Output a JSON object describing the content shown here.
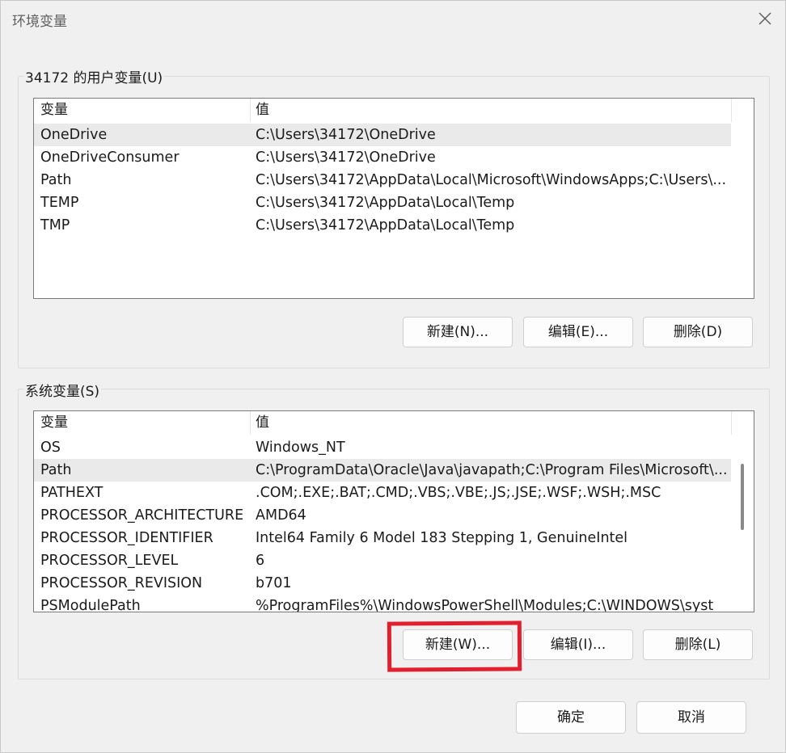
{
  "window": {
    "title": "环境变量"
  },
  "icons": {
    "close": "close-icon"
  },
  "user_vars": {
    "group_label": "34172 的用户变量(U)",
    "headers": [
      "变量",
      "值"
    ],
    "rows": [
      {
        "name": "OneDrive",
        "value": "C:\\Users\\34172\\OneDrive"
      },
      {
        "name": "OneDriveConsumer",
        "value": "C:\\Users\\34172\\OneDrive"
      },
      {
        "name": "Path",
        "value": "C:\\Users\\34172\\AppData\\Local\\Microsoft\\WindowsApps;C:\\Users\\..."
      },
      {
        "name": "TEMP",
        "value": "C:\\Users\\34172\\AppData\\Local\\Temp"
      },
      {
        "name": "TMP",
        "value": "C:\\Users\\34172\\AppData\\Local\\Temp"
      }
    ],
    "selected_row": 0,
    "buttons": {
      "new": "新建(N)...",
      "edit": "编辑(E)...",
      "delete": "删除(D)"
    }
  },
  "system_vars": {
    "group_label": "系统变量(S)",
    "headers": [
      "变量",
      "值"
    ],
    "rows": [
      {
        "name": "OS",
        "value": "Windows_NT"
      },
      {
        "name": "Path",
        "value": "C:\\ProgramData\\Oracle\\Java\\javapath;C:\\Program Files\\Microsoft\\..."
      },
      {
        "name": "PATHEXT",
        "value": ".COM;.EXE;.BAT;.CMD;.VBS;.VBE;.JS;.JSE;.WSF;.WSH;.MSC"
      },
      {
        "name": "PROCESSOR_ARCHITECTURE",
        "value": "AMD64"
      },
      {
        "name": "PROCESSOR_IDENTIFIER",
        "value": "Intel64 Family 6 Model 183 Stepping 1, GenuineIntel"
      },
      {
        "name": "PROCESSOR_LEVEL",
        "value": "6"
      },
      {
        "name": "PROCESSOR_REVISION",
        "value": "b701"
      },
      {
        "name": "PSModulePath",
        "value": "%ProgramFiles%\\WindowsPowerShell\\Modules;C:\\WINDOWS\\syst"
      }
    ],
    "selected_row": 1,
    "buttons": {
      "new": "新建(W)...",
      "edit": "编辑(I)...",
      "delete": "删除(L)"
    }
  },
  "dialog_buttons": {
    "ok": "确定",
    "cancel": "取消"
  },
  "colors": {
    "highlight": "#e0202e",
    "selected_row": "#eaeaea"
  }
}
